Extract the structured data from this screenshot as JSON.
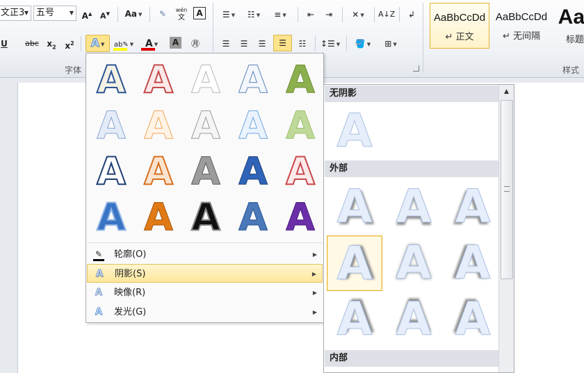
{
  "ribbon": {
    "font": {
      "name": "文正3",
      "size": "五号",
      "group_label": "字体",
      "highlight_bar_color": "#ffff00",
      "font_color_bar": "#e00000"
    },
    "styles": {
      "group_label": "样式",
      "items": [
        {
          "sample": "AaBbCcDd",
          "name": "正文"
        },
        {
          "sample": "AaBbCcDd",
          "name": "无间隔"
        },
        {
          "sample": "Aal",
          "name": "标题"
        }
      ]
    }
  },
  "effects_menu": {
    "items": [
      {
        "label": "轮廓(O)",
        "icon": "outline-pen-icon"
      },
      {
        "label": "阴影(S)",
        "icon": "shadow-a-icon"
      },
      {
        "label": "映像(R)",
        "icon": "reflection-a-icon"
      },
      {
        "label": "发光(G)",
        "icon": "glow-a-icon"
      }
    ]
  },
  "shadow_submenu": {
    "sections": [
      {
        "title": "无阴影"
      },
      {
        "title": "外部"
      },
      {
        "title": "内部"
      }
    ]
  },
  "colors": {
    "highlight": "#fde79a",
    "selected_border": "#e6b32c",
    "accent_blue": "#3b6bb3"
  }
}
